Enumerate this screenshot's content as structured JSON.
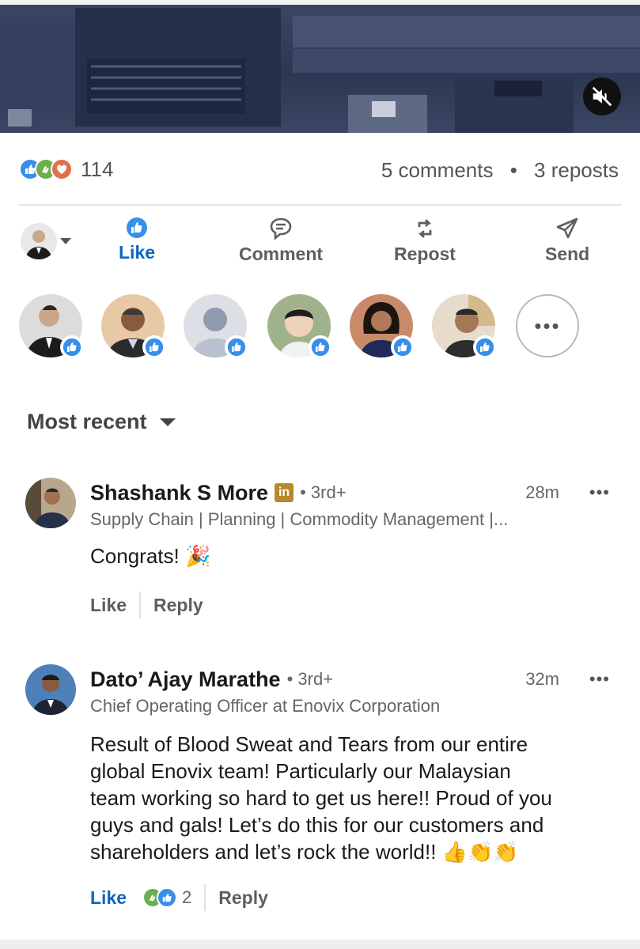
{
  "video": {
    "mute_icon": "speaker-muted-icon"
  },
  "stats": {
    "reaction_count": "114",
    "comments": "5 comments",
    "separator": "•",
    "reposts": "3 reposts"
  },
  "actions": {
    "like": "Like",
    "comment": "Comment",
    "repost": "Repost",
    "send": "Send"
  },
  "likers": {
    "more": "•••"
  },
  "sort": {
    "label": "Most recent"
  },
  "comments": [
    {
      "name": "Shashank S More",
      "badge": "in",
      "degree": "• 3rd+",
      "time": "28m",
      "more": "•••",
      "title": "Supply Chain | Planning | Commodity Management |...",
      "body": "Congrats! 🎉",
      "like": "Like",
      "reply": "Reply"
    },
    {
      "name": "Dato’ Ajay Marathe",
      "degree": "• 3rd+",
      "time": "32m",
      "more": "•••",
      "title": "Chief Operating Officer at Enovix Corporation",
      "body_lines": [
        "Result of Blood Sweat and Tears from our entire",
        "global Enovix team! Particularly our Malaysian",
        "team working so hard to get us here!! Proud of you",
        "guys and gals! Let’s do this for our customers and",
        "shareholders and let’s rock the world!! 👍👏👏"
      ],
      "like": "Like",
      "reaction_count": "2",
      "reply": "Reply"
    }
  ],
  "colors": {
    "accent_blue": "#0a66c2",
    "like_icon_blue": "#378fe9",
    "support_green": "#6dae4f",
    "love_orange": "#df704d"
  }
}
